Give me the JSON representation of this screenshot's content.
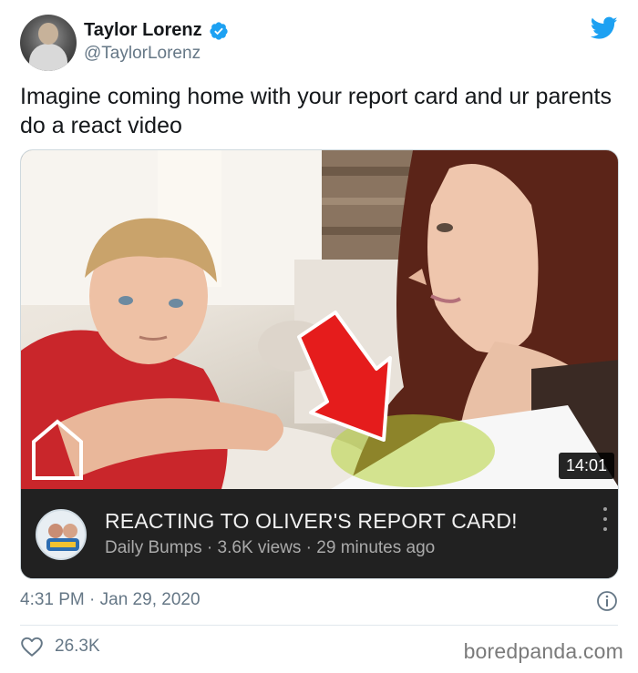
{
  "author": {
    "name": "Taylor Lorenz",
    "handle": "@TaylorLorenz"
  },
  "tweet": {
    "text": "Imagine coming home with your report card and ur parents do a react video",
    "timestamp": "4:31 PM · Jan 29, 2020",
    "likes": "26.3K"
  },
  "video": {
    "duration": "14:01",
    "title": "REACTING TO OLIVER'S REPORT CARD!",
    "meta": "Daily Bumps · 3.6K views · 29 minutes ago"
  },
  "icons": {
    "verified": "verified-badge-icon",
    "brand": "twitter-bird-icon",
    "info": "info-icon",
    "like": "heart-icon",
    "more": "more-vertical-icon"
  },
  "colors": {
    "twitter_blue": "#1da1f2",
    "arrow_red": "#e51c1c",
    "card_bar": "#212121"
  },
  "watermark": "boredpanda.com"
}
